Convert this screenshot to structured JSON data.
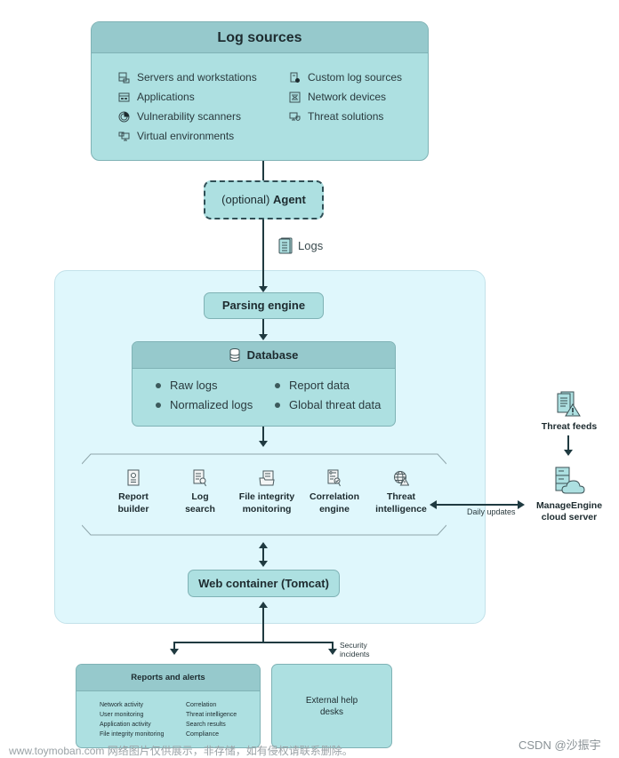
{
  "log_sources": {
    "title": "Log sources",
    "items_left": [
      {
        "label": "Servers and workstations",
        "icon": "server-icon"
      },
      {
        "label": "Applications",
        "icon": "application-icon"
      },
      {
        "label": "Vulnerability scanners",
        "icon": "radar-icon"
      },
      {
        "label": "Virtual environments",
        "icon": "virtual-monitor-icon"
      }
    ],
    "items_right": [
      {
        "label": "Custom log sources",
        "icon": "custom-log-icon"
      },
      {
        "label": "Network devices",
        "icon": "network-device-icon"
      },
      {
        "label": "Threat solutions",
        "icon": "threat-solution-icon"
      }
    ]
  },
  "agent": {
    "prefix": "(optional)",
    "label": "Agent"
  },
  "logs_label": "Logs",
  "parsing_engine": "Parsing engine",
  "database": {
    "title": "Database",
    "items": [
      "Raw logs",
      "Normalized logs",
      "Report data",
      "Global threat data"
    ]
  },
  "modules": [
    {
      "line1": "Report",
      "line2": "builder",
      "icon": "report-builder-icon"
    },
    {
      "line1": "Log",
      "line2": "search",
      "icon": "log-search-icon"
    },
    {
      "line1": "File integrity",
      "line2": "monitoring",
      "icon": "file-folder-icon"
    },
    {
      "line1": "Correlation",
      "line2": "engine",
      "icon": "correlation-icon"
    },
    {
      "line1": "Threat",
      "line2": "intelligence",
      "icon": "globe-warning-icon"
    }
  ],
  "daily_updates": "Daily updates",
  "threat_feeds": "Threat feeds",
  "cloud_server": {
    "line1": "ManageEngine",
    "line2": "cloud server"
  },
  "web_container": "Web container (Tomcat)",
  "security_incidents": {
    "line1": "Security",
    "line2": "incidents"
  },
  "reports": {
    "title": "Reports and alerts",
    "left": [
      "Network activity",
      "User monitoring",
      "Application activity",
      "File integrity monitoring"
    ],
    "right": [
      "Correlation",
      "Threat intelligence",
      "Search results",
      "Compliance"
    ]
  },
  "helpdesk": {
    "line1": "External help",
    "line2": "desks"
  },
  "watermarks": {
    "left": "www.toymoban.com 网络图片仅供展示，非存储，如有侵权请联系删除。",
    "right": "CSDN @沙振宇"
  },
  "colors": {
    "box_fill": "#ade0e1",
    "box_header": "#96c9cc",
    "panel_bg": "#dff7fc",
    "line": "#1f3a40"
  }
}
